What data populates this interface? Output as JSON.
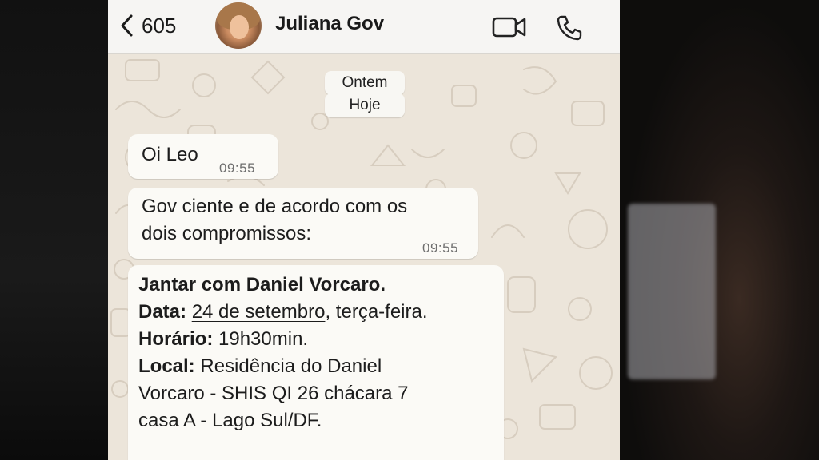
{
  "header": {
    "back_label": "605",
    "contact_name": "Juliana Gov",
    "icons": [
      "chevron-left-icon",
      "video-camera-icon",
      "phone-icon"
    ]
  },
  "chat": {
    "date_labels": [
      "Ontem",
      "Hoje"
    ],
    "messages": [
      {
        "text": "Oi Leo",
        "time": "09:55"
      },
      {
        "lines": [
          "Gov ciente e de acordo com os",
          "dois compromissos:"
        ],
        "time": "09:55"
      },
      {
        "title": "Jantar com Daniel Vorcaro.",
        "data_label": "Data:",
        "data_value_link": "24 de setembro",
        "data_value_rest": ", terça-feira.",
        "horario_label": "Horário:",
        "horario_value": " 19h30min.",
        "local_label": "Local:",
        "local_lines": [
          " Residência do Daniel",
          "Vorcaro - SHIS QI 26 chácara 7",
          "casa A - Lago Sul/DF."
        ]
      }
    ]
  },
  "colors": {
    "chat_background": "#ece5da",
    "bubble": "#fbfaf6",
    "header": "#f6f5f3",
    "timestamp": "#6e6e6e"
  }
}
